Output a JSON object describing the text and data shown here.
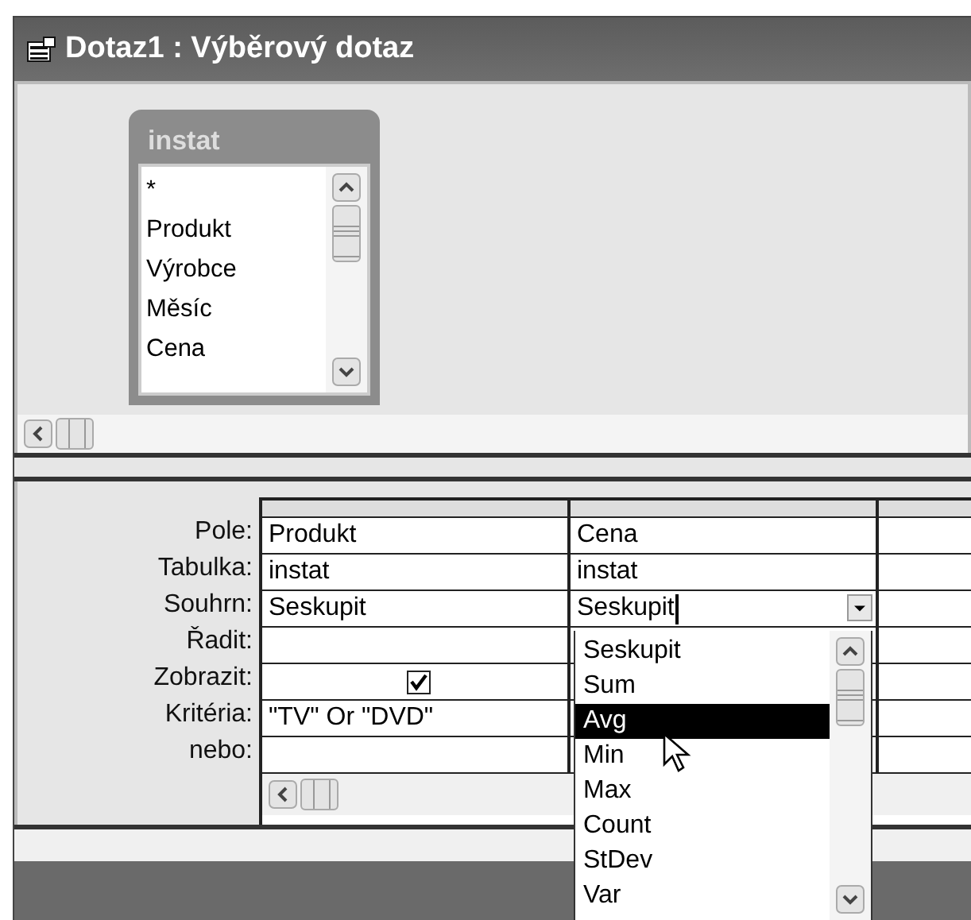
{
  "window": {
    "title": "Dotaz1 : Výběrový dotaz"
  },
  "table_box": {
    "title": "instat",
    "fields": [
      "*",
      "Produkt",
      "Výrobce",
      "Měsíc",
      "Cena"
    ]
  },
  "grid": {
    "rows": [
      {
        "label": "Pole:",
        "cells": [
          {
            "kind": "text",
            "value": "Produkt"
          },
          {
            "kind": "text",
            "value": "Cena"
          }
        ]
      },
      {
        "label": "Tabulka:",
        "cells": [
          {
            "kind": "text",
            "value": "instat"
          },
          {
            "kind": "text",
            "value": "instat"
          }
        ]
      },
      {
        "label": "Souhrn:",
        "cells": [
          {
            "kind": "text",
            "value": "Seskupit"
          },
          {
            "kind": "combo",
            "value": "Seskupit"
          }
        ]
      },
      {
        "label": "Řadit:",
        "cells": []
      },
      {
        "label": "Zobrazit:",
        "cells": [
          {
            "kind": "checkbox",
            "checked": true
          }
        ]
      },
      {
        "label": "Kritéria:",
        "cells": [
          {
            "kind": "text",
            "value": "\"TV\" Or \"DVD\""
          }
        ]
      },
      {
        "label": "nebo:",
        "cells": []
      }
    ]
  },
  "dropdown": {
    "items": [
      {
        "label": "Seskupit",
        "selected": false
      },
      {
        "label": "Sum",
        "selected": false
      },
      {
        "label": "Avg",
        "selected": true
      },
      {
        "label": "Min",
        "selected": false
      },
      {
        "label": "Max",
        "selected": false
      },
      {
        "label": "Count",
        "selected": false
      },
      {
        "label": "StDev",
        "selected": false
      },
      {
        "label": "Var",
        "selected": false
      }
    ]
  }
}
